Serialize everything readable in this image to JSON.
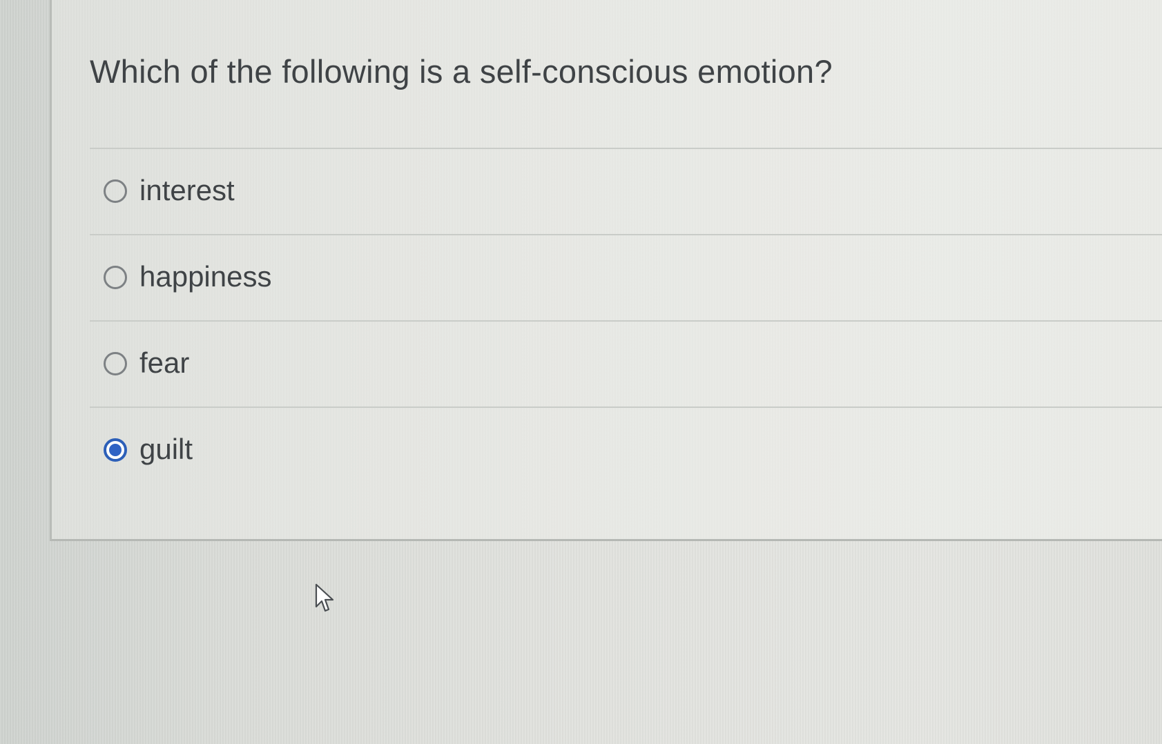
{
  "question": {
    "title": "Which of the following is a self-conscious emotion?"
  },
  "options": [
    {
      "label": "interest",
      "selected": false
    },
    {
      "label": "happiness",
      "selected": false
    },
    {
      "label": "fear",
      "selected": false
    },
    {
      "label": "guilt",
      "selected": true
    }
  ],
  "colors": {
    "radio_selected": "#2f63c4",
    "text": "#3f4346"
  },
  "cursor": {
    "icon": "arrow-pointer-icon"
  }
}
